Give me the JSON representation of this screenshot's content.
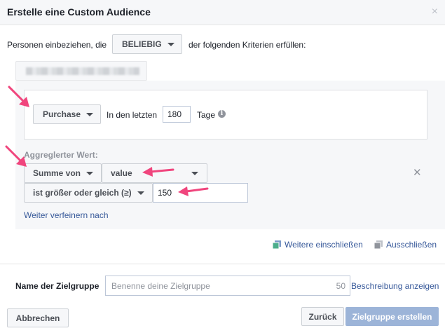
{
  "dialog": {
    "title": "Erstelle eine Custom Audience",
    "close_glyph": "×"
  },
  "criteria": {
    "prefix": "Personen einbeziehen, die",
    "mode": "BELIEBIG",
    "suffix": "der folgenden Kriterien erfüllen:"
  },
  "event": {
    "name": "Purchase",
    "within_label": "In den letzten",
    "days": "180",
    "days_unit": "Tage"
  },
  "aggregate": {
    "label": "Aggreglerter Wert:",
    "function": "Summe von",
    "parameter": "value",
    "operator": "ist größer oder gleich (≥)",
    "amount": "150",
    "refine_link": "Weiter verfeinern nach"
  },
  "actions": {
    "include_more": "Weitere einschließen",
    "exclude": "Ausschließen"
  },
  "audience_name": {
    "label": "Name der Zielgruppe",
    "placeholder": "Benenne deine Zielgruppe",
    "char_count": "50",
    "description_link": "Beschreibung anzeigen"
  },
  "footer": {
    "cancel": "Abbrechen",
    "back": "Zurück",
    "create": "Zielgruppe erstellen"
  },
  "colors": {
    "link": "#365899",
    "annotation_arrow": "#f0457d",
    "primary_disabled": "#9cb4d8"
  }
}
